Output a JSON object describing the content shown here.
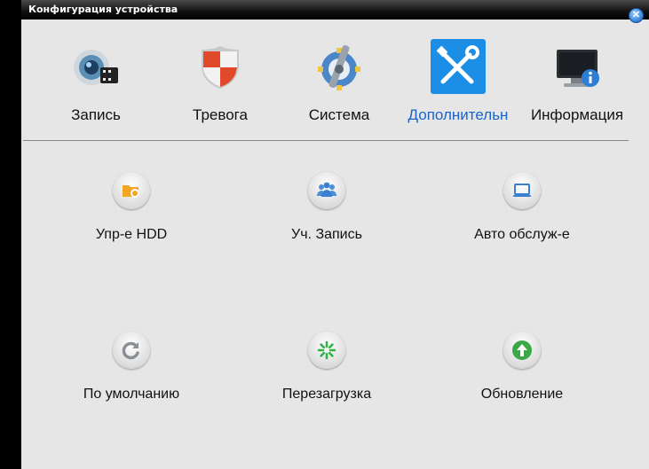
{
  "window": {
    "title": "Конфигурация устройства"
  },
  "tabs": [
    {
      "label": "Запись",
      "icon": "camera-record-icon"
    },
    {
      "label": "Тревога",
      "icon": "shield-alarm-icon"
    },
    {
      "label": "Система",
      "icon": "wrench-gear-icon"
    },
    {
      "label": "Дополнительн",
      "icon": "tools-icon",
      "active": true
    },
    {
      "label": "Информация",
      "icon": "monitor-info-icon"
    }
  ],
  "items": [
    {
      "label": "Упр-е HDD",
      "icon": "hdd-folder-icon"
    },
    {
      "label": "Уч. Запись",
      "icon": "users-icon"
    },
    {
      "label": "Авто обслуж-е",
      "icon": "laptop-icon"
    },
    {
      "label": "По умолчанию",
      "icon": "reset-icon"
    },
    {
      "label": "Перезагрузка",
      "icon": "reboot-spinner-icon"
    },
    {
      "label": "Обновление",
      "icon": "upgrade-arrow-icon"
    }
  ],
  "colors": {
    "active_tab_text": "#1a64c8",
    "tools_tile": "#1c8ee6"
  }
}
